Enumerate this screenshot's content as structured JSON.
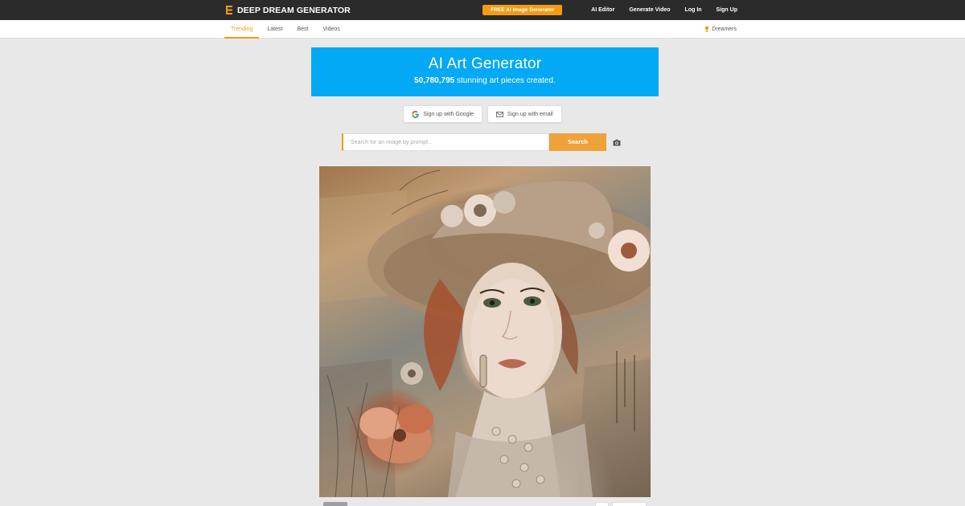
{
  "header": {
    "brand": "DEEP DREAM GENERATOR",
    "cta": "FREE AI Image Generator",
    "links": [
      "AI Editor",
      "Generate Video",
      "Log In",
      "Sign Up"
    ]
  },
  "subnav": {
    "tabs": [
      "Trending",
      "Latest",
      "Best",
      "Videos"
    ],
    "active_tab": "Trending",
    "dreamers": "Dreamers"
  },
  "hero": {
    "title": "AI Art Generator",
    "count": "50,780,795",
    "subtitle_rest": " stunning art pieces created."
  },
  "signup": {
    "google": "Sign up with Google",
    "email": "Sign up with email"
  },
  "search": {
    "placeholder": "Search for an image by prompt...",
    "button": "Search"
  },
  "colors": {
    "accent": "#f39c12",
    "hero_bg": "#03a9f4",
    "topbar_bg": "#2b2b2b",
    "page_bg": "#e8e8e8"
  },
  "icons": {
    "brand": "logo-icon",
    "dreamers": "trophy-icon",
    "google": "google-icon",
    "email": "mail-icon",
    "camera": "camera-icon"
  }
}
